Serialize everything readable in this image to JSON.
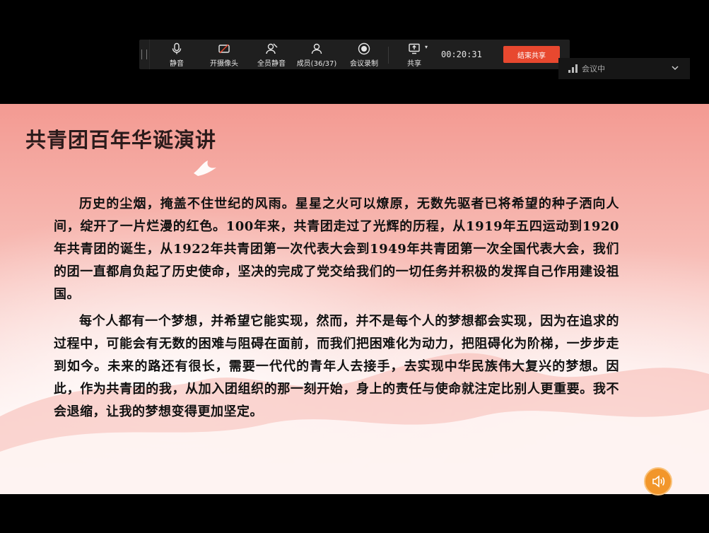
{
  "toolbar": {
    "mute_label": "静音",
    "camera_label": "开摄像头",
    "mute_all_label": "全员静音",
    "members_label": "成员(36/37)",
    "record_label": "会议录制",
    "share_label": "共享",
    "timer": "00:20:31",
    "end_share_label": "结束共享"
  },
  "status": {
    "label": "会议中"
  },
  "slide": {
    "title": "共青团百年华诞演讲",
    "paragraphs": [
      "历史的尘烟，掩盖不住世纪的风雨。星星之火可以燎原，无数先驱者已将希望的种子洒向人间，绽开了一片烂漫的红色。100年来，共青团走过了光辉的历程，从1919年五四运动到1920年共青团的诞生，从1922年共青团第一次代表大会到1949年共青团第一次全国代表大会，我们的团一直都肩负起了历史使命，坚决的完成了党交给我们的一切任务并积极的发挥自己作用建设祖国。",
      "每个人都有一个梦想，并希望它能实现，然而，并不是每个人的梦想都会实现，因为在追求的过程中，可能会有无数的困难与阻碍在面前，而我们把困难化为动力，把阻碍化为阶梯，一步步走到如今。未来的路还有很长，需要一代代的青年人去接手，去实现中华民族伟大复兴的梦想。因此，作为共青团的我，从加入团组织的那一刻开始，身上的责任与使命就注定比别人更重要。我不会退缩，让我的梦想变得更加坚定。"
    ]
  },
  "colors": {
    "toolbar_bg": "#1f1f1f",
    "end_share_bg": "#e8482f",
    "speaker_bg": "#f2962b"
  },
  "icons": [
    "grip-icon",
    "microphone-icon",
    "camera-off-icon",
    "mute-all-icon",
    "members-icon",
    "record-icon",
    "share-screen-icon",
    "signal-icon",
    "chevron-down-icon",
    "dove-icon",
    "speaker-icon"
  ]
}
